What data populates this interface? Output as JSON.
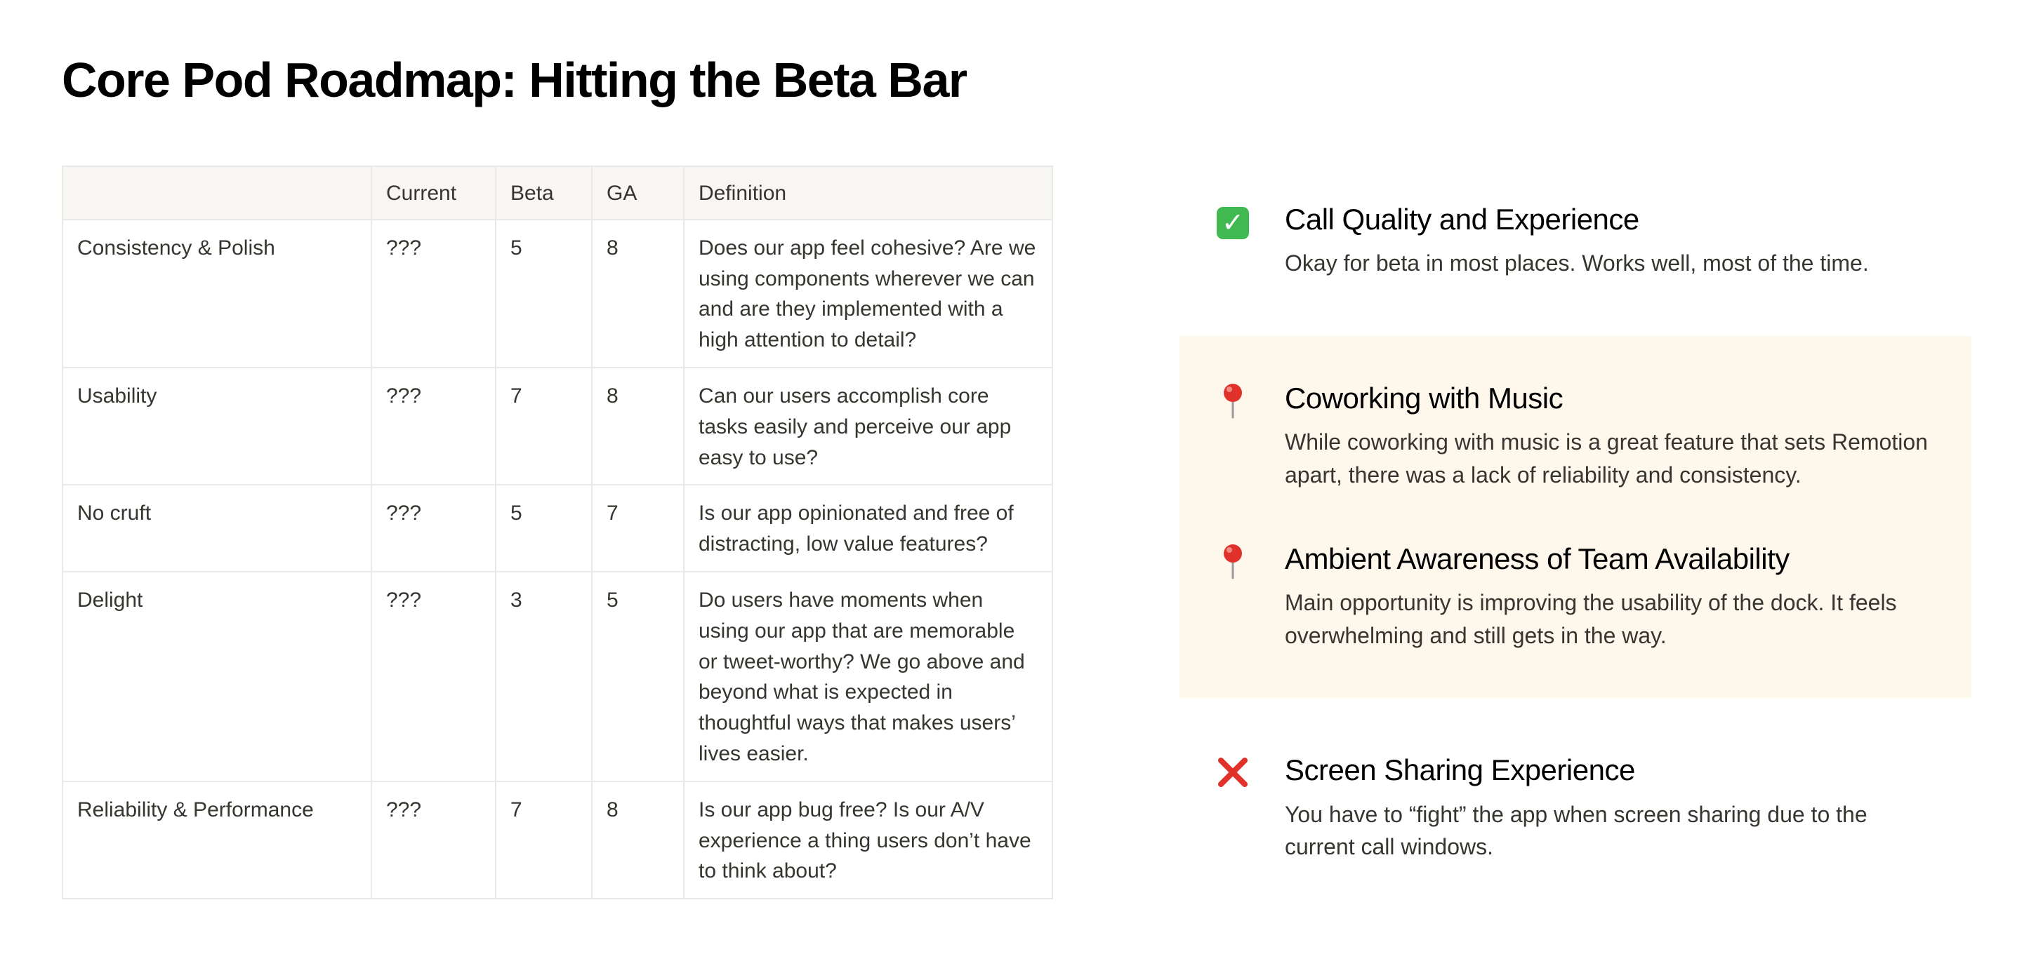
{
  "title": "Core Pod Roadmap: Hitting the Beta Bar",
  "table": {
    "headers": [
      "",
      "Current",
      "Beta",
      "GA",
      "Definition"
    ],
    "rows": [
      {
        "name": "Consistency & Polish",
        "current": "???",
        "beta": "5",
        "ga": "8",
        "definition": "Does our app feel cohesive? Are we using components wherever we can and are they implemented with a high attention to detail?"
      },
      {
        "name": "Usability",
        "current": "???",
        "beta": "7",
        "ga": "8",
        "definition": "Can our users accomplish core tasks easily and perceive our app easy to use?"
      },
      {
        "name": "No cruft",
        "current": "???",
        "beta": "5",
        "ga": "7",
        "definition": "Is our app opinionated and free of distracting, low value features?"
      },
      {
        "name": "Delight",
        "current": "???",
        "beta": "3",
        "ga": "5",
        "definition": "Do users have moments when using our app that are memorable or tweet-worthy? We go above and beyond what is expected in thoughtful ways that makes users’ lives easier."
      },
      {
        "name": "Reliability & Performance",
        "current": "???",
        "beta": "7",
        "ga": "8",
        "definition": "Is our app bug free? Is our A/V experience a thing users don’t have to think about?"
      }
    ]
  },
  "items": [
    {
      "icon": "check-mark-icon",
      "title": "Call Quality and Experience",
      "description": "Okay for beta in most places. Works well, most of the time."
    },
    {
      "icon": "pushpin-icon",
      "title": "Coworking with Music",
      "description": "While coworking with music is a great feature that sets Remotion apart, there was a lack of reliability and consistency."
    },
    {
      "icon": "pushpin-icon",
      "title": "Ambient Awareness of Team Availability",
      "description": "Main opportunity is improving the usability of the dock. It feels overwhelming and still gets in the way."
    },
    {
      "icon": "cross-mark-icon",
      "title": "Screen Sharing Experience",
      "description": "You have to “fight” the app when screen sharing due to the current call windows."
    }
  ],
  "colors": {
    "highlight_background": "#fdf7ec",
    "check_green": "#3fb950",
    "pin_red": "#e0322a",
    "cross_red": "#e0322a",
    "table_header_background": "#f7f6f3",
    "table_border": "#e9e9e7"
  }
}
